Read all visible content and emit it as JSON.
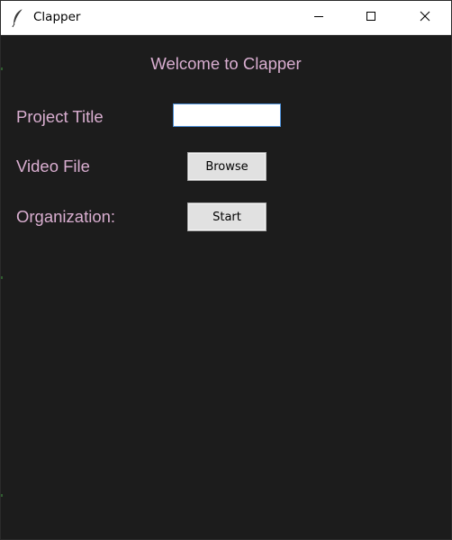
{
  "window": {
    "title": "Clapper",
    "icon": "feather-icon",
    "controls": {
      "minimize_icon": "minimize-icon",
      "maximize_icon": "maximize-icon",
      "close_icon": "close-icon"
    }
  },
  "main": {
    "welcome": "Welcome to Clapper",
    "project_title": {
      "label": "Project Title",
      "value": ""
    },
    "video_file": {
      "label": "Video File",
      "button_label": "Browse"
    },
    "organization": {
      "label": "Organization:",
      "button_label": "Start"
    }
  },
  "colors": {
    "background": "#1c1c1c",
    "label_text": "#d9aed0",
    "titlebar": "#ffffff",
    "button_face": "#e1e1e1",
    "input_border": "#4b8ed6"
  }
}
